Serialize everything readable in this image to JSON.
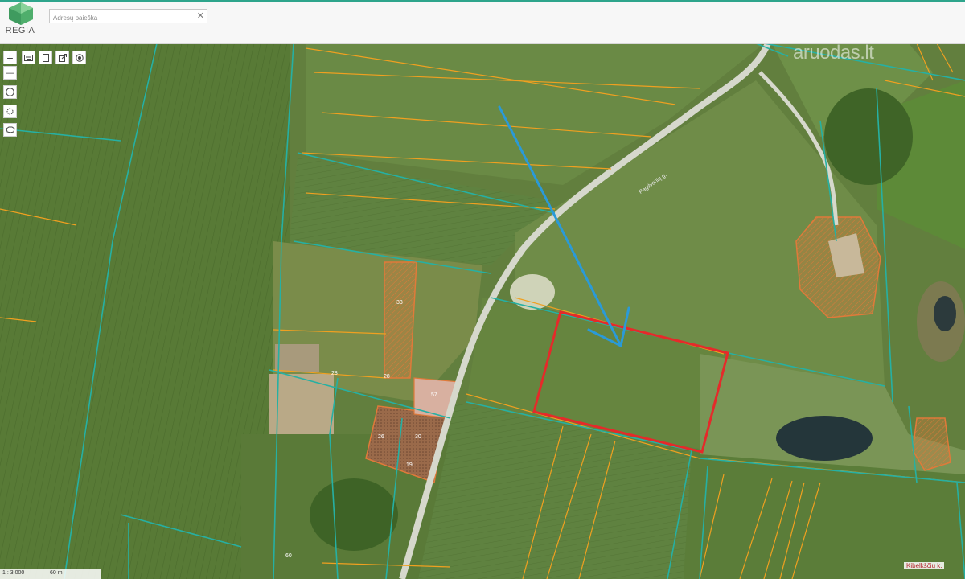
{
  "app": {
    "logo_text": "REGIA"
  },
  "search": {
    "placeholder": "Adresų paieška",
    "clear_symbol": "✕"
  },
  "toolbar": {
    "zoom_in": "+",
    "zoom_out": "—",
    "tools": [
      "keyboard-icon",
      "document-icon",
      "export-icon",
      "target-icon",
      "info-icon",
      "settings-icon",
      "lithuania-outline-icon"
    ]
  },
  "watermark": {
    "text": "aruodas.lt"
  },
  "map": {
    "road_name": "Pagilvonių g.",
    "locality": "Kibelkščių k.",
    "parcel_numbers": [
      "33",
      "28",
      "28",
      "57",
      "26",
      "30",
      "19",
      "60"
    ],
    "selected_parcel_color": "#e52a2a",
    "arrow_color": "#2a9ad8",
    "parcel_boundary_color": "#f0a020",
    "cadastral_boundary_color": "#26b0a3"
  },
  "scale": {
    "ratio": "1 : 3 000",
    "distance": "60 m"
  }
}
